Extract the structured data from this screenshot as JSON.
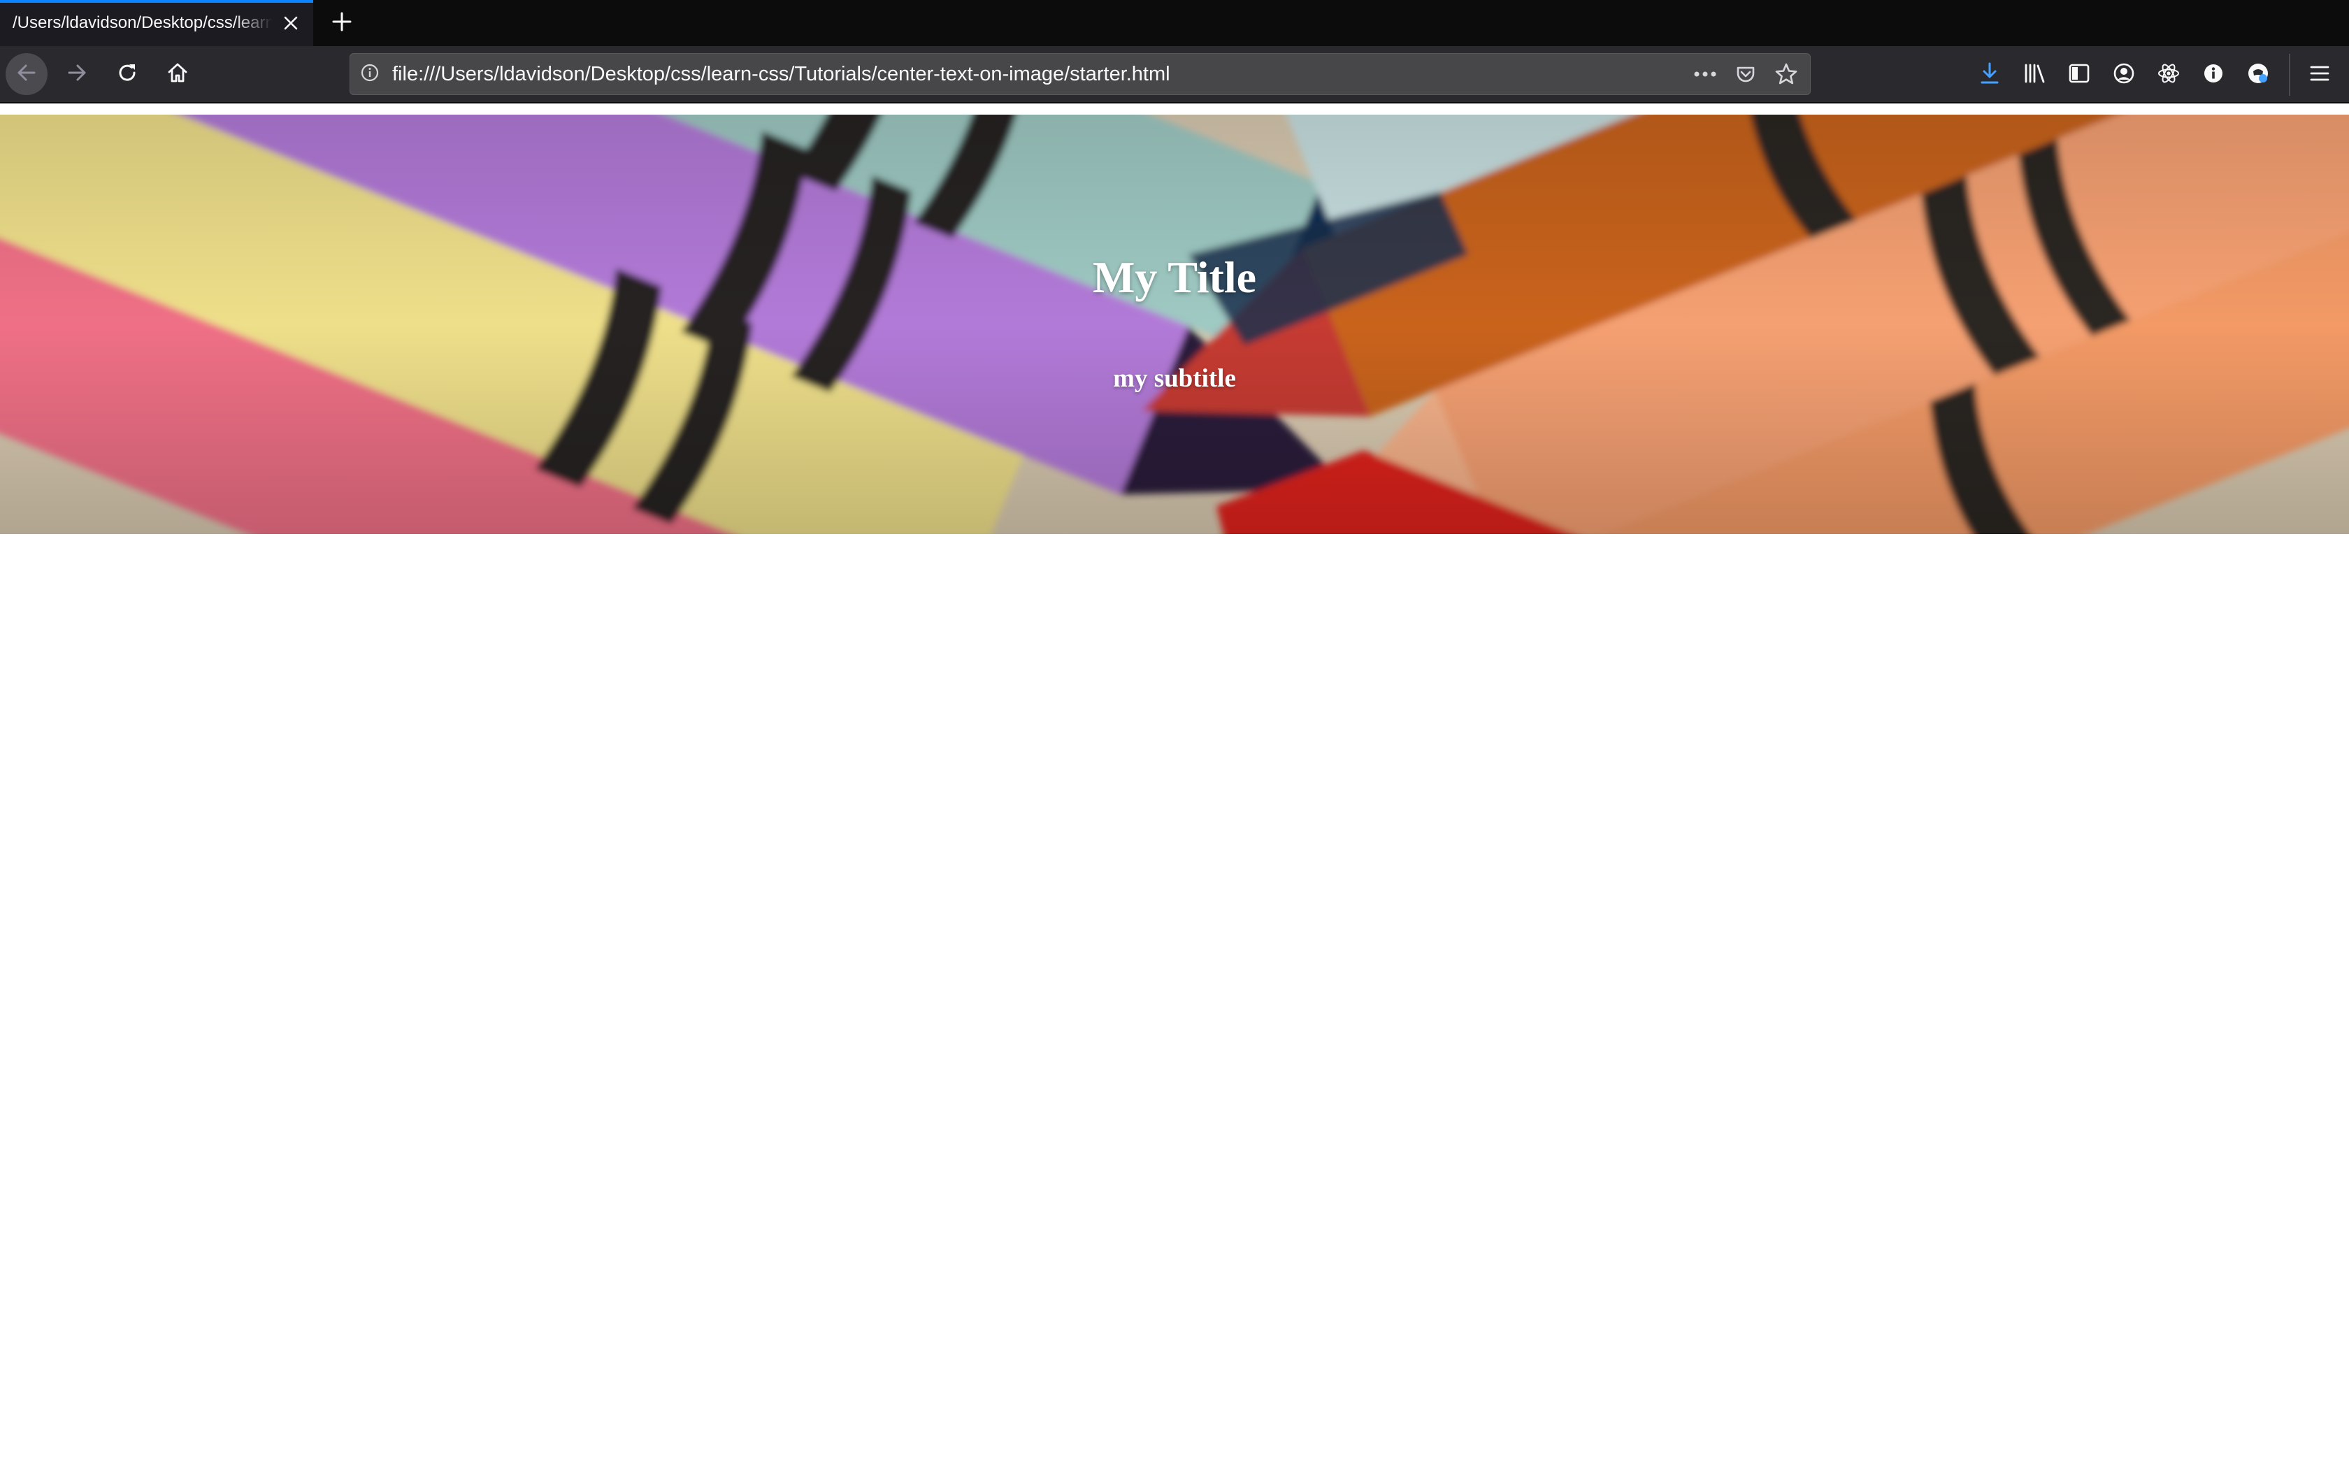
{
  "browser": {
    "tab": {
      "title": "/Users/ldavidson/Desktop/css/learn-css/Tutorials/center-text-on-image/starter.html"
    },
    "url": "file:///Users/ldavidson/Desktop/css/learn-css/Tutorials/center-text-on-image/starter.html",
    "icons": {
      "tab_close": "close-icon",
      "new_tab": "plus-icon",
      "back": "arrow-left-icon",
      "forward": "arrow-right-icon",
      "reload": "reload-icon",
      "home": "home-icon",
      "site_info": "info-icon",
      "page_actions": "more-dots-icon",
      "pocket": "pocket-icon",
      "bookmark": "star-icon",
      "downloads": "download-icon",
      "library": "library-icon",
      "sidebar": "sidebar-icon",
      "account": "account-icon",
      "react_devtools": "react-icon",
      "extension_info": "info-circle-icon",
      "extension_mask": "mask-icon",
      "menu": "hamburger-menu-icon"
    },
    "colors": {
      "accent": "#0a84ff",
      "toolbar": "#2a2a2e",
      "tabstrip": "#0c0c0d",
      "downloads_active": "#45a1ff"
    }
  },
  "page": {
    "hero": {
      "title": "My Title",
      "subtitle": "my subtitle",
      "image_description": "close-up photo of crayons",
      "image_icon": "crayons-photo"
    }
  }
}
